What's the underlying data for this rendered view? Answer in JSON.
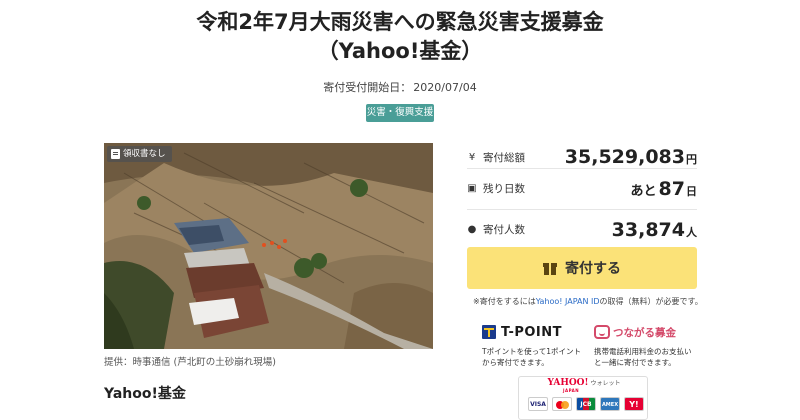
{
  "title": {
    "line1": "令和2年7月大雨災害への緊急災害支援募金",
    "line2": "（Yahoo!基金）"
  },
  "start_date": {
    "label": "寄付受付開始日：",
    "value": "2020/07/04"
  },
  "category_tag": "災害・復興支援",
  "photo": {
    "badge": "領収書なし",
    "caption": "提供：時事通信 (芦北町の土砂崩れ現場)"
  },
  "section_title": "Yahoo!基金",
  "stats": {
    "total": {
      "icon": "yen-icon",
      "label": "寄付総額",
      "value": "35,529,083",
      "unit": "円"
    },
    "days_left": {
      "icon": "calendar-icon",
      "label": "残り日数",
      "prefix": "あと",
      "value": "87",
      "unit": "日"
    },
    "donors": {
      "icon": "person-icon",
      "label": "寄付人数",
      "value": "33,874",
      "unit": "人"
    }
  },
  "donate_button": {
    "label": "寄付する",
    "icon": "gift-icon"
  },
  "note": {
    "prefix": "※寄付をするには",
    "link": "Yahoo! JAPAN ID",
    "suffix": "の取得（無料）が必要です。"
  },
  "tpoint": {
    "logo": "T-POINT",
    "desc_line1": "Tポイントを使って1ポイント",
    "desc_line2": "から寄付できます。"
  },
  "tsunagaru": {
    "logo": "つながる募金",
    "desc_line1": "携帯電話利用料金のお支払い",
    "desc_line2": "と一緒に寄付できます。"
  },
  "wallet": {
    "logo": "YAHOO!",
    "logo_sub": "JAPAN",
    "logo_suffix": "ウォレット",
    "cards": [
      "VISA",
      "JCB",
      "AMEX",
      "Y!"
    ]
  },
  "colors": {
    "tag_bg": "#4a9e97",
    "button_bg": "#fbe278",
    "link": "#2a6bc6",
    "yahoo_red": "#e60033"
  }
}
